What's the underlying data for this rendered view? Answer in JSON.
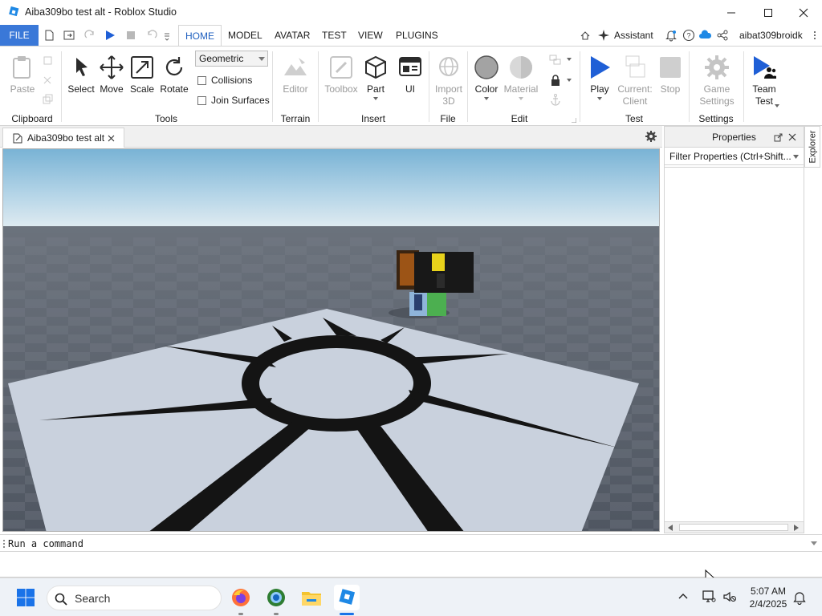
{
  "window": {
    "title": "Aiba309bo  test alt - Roblox Studio"
  },
  "ribbon_tabs": {
    "file": "FILE",
    "tabs": [
      "HOME",
      "MODEL",
      "AVATAR",
      "TEST",
      "VIEW",
      "PLUGINS"
    ],
    "active": "HOME"
  },
  "header_right": {
    "assistant": "Assistant",
    "username": "aibat309broidk"
  },
  "home": {
    "clipboard": {
      "paste": "Paste",
      "group": "Clipboard"
    },
    "tools": {
      "select": "Select",
      "move": "Move",
      "scale": "Scale",
      "rotate": "Rotate",
      "mode": "Geometric",
      "collisions": "Collisions",
      "join_surfaces": "Join Surfaces",
      "group": "Tools"
    },
    "terrain": {
      "editor": "Editor",
      "group": "Terrain"
    },
    "insert": {
      "toolbox": "Toolbox",
      "part": "Part",
      "ui": "UI",
      "group": "Insert"
    },
    "file": {
      "import3d_line1": "Import",
      "import3d_line2": "3D",
      "group": "File"
    },
    "edit": {
      "color": "Color",
      "material": "Material",
      "group": "Edit"
    },
    "test": {
      "play": "Play",
      "current_line1": "Current:",
      "current_line2": "Client",
      "stop": "Stop",
      "group": "Test"
    },
    "settings": {
      "game_line1": "Game",
      "game_line2": "Settings",
      "group": "Settings"
    },
    "team": {
      "line1": "Team",
      "line2": "Test"
    }
  },
  "document": {
    "tab_title": "Aiba309bo  test alt"
  },
  "properties": {
    "title": "Properties",
    "filter_placeholder": "Filter Properties (Ctrl+Shift..."
  },
  "explorer_tab": "Explorer",
  "command_bar": {
    "placeholder": "Run a command"
  },
  "taskbar": {
    "search_placeholder": "Search",
    "time": "5:07 AM",
    "date": "2/4/2025"
  },
  "colors": {
    "accent": "#3a78d8",
    "play_blue": "#1f5fd6",
    "sky_top": "#7fb8d9",
    "baseplate": "#5c6470",
    "decal_plate": "#c7cfdc"
  }
}
